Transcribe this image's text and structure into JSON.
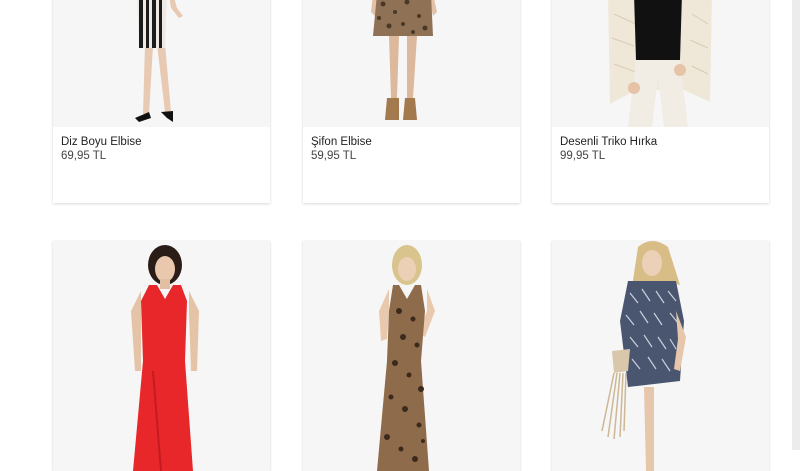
{
  "products": [
    {
      "name": "Diz Boyu Elbise",
      "price": "69,95  TL",
      "image": "model-striped-knee-dress"
    },
    {
      "name": "Şifon Elbise",
      "price": "59,95  TL",
      "image": "model-leopard-chiffon-dress"
    },
    {
      "name": "Desenli Triko Hırka",
      "price": "99,95  TL",
      "image": "model-knit-cardigan"
    },
    {
      "name": "",
      "price": "",
      "image": "model-red-maxi-dress"
    },
    {
      "name": "",
      "price": "",
      "image": "model-leopard-maxi-dress"
    },
    {
      "name": "",
      "price": "",
      "image": "model-patterned-dress-fringe-bag"
    }
  ],
  "colors": {
    "card_bg": "#ffffff",
    "photo_bg": "#f6f6f6",
    "text": "#222222"
  }
}
